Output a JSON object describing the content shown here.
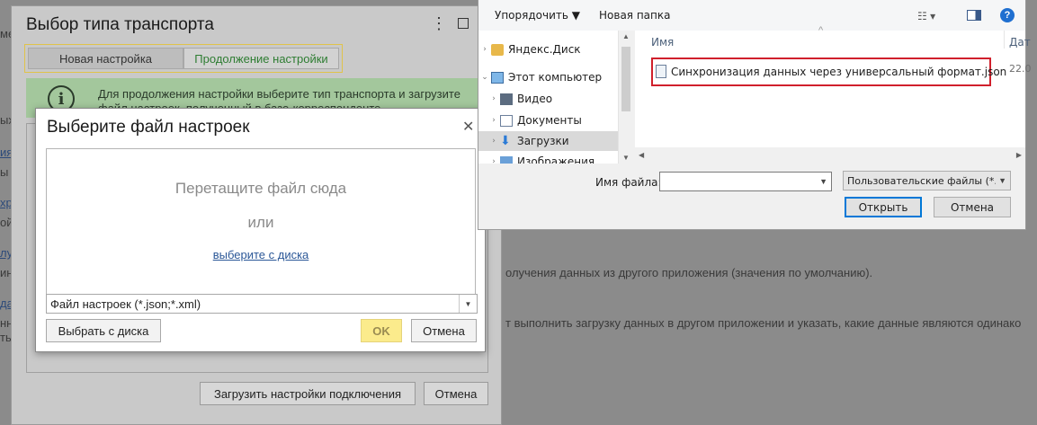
{
  "background": {
    "texts": [
      "мe",
      "ых",
      "ия",
      "ы",
      "хр",
      "ой",
      "лу",
      "инх",
      "дак",
      "нны",
      "ть"
    ],
    "line1": "олучения данных из другого приложения (значения по умолчанию).",
    "line2": "т выполнить загрузку данных в другом приложении и указать, какие данные являются одинако"
  },
  "transport_dialog": {
    "title": "Выбор типа транспорта",
    "tabs": [
      {
        "label": "Новая настройка"
      },
      {
        "label": "Продолжение настройки"
      }
    ],
    "info_text": "Для продолжения настройки выберите тип транспорта и загрузите файл настроек, полученный в базе-корреспонденте",
    "load_button": "Загрузить настройки подключения",
    "cancel_button": "Отмена"
  },
  "choose_file_dialog": {
    "title": "Выберите файл настроек",
    "drop_text": "Перетащите файл сюда",
    "or_text": "или",
    "choose_link": "выберите с диска",
    "filter": "Файл настроек (*.json;*.xml)",
    "choose_from_disk_button": "Выбрать с диска",
    "ok_button": "OK",
    "cancel_button": "Отмена"
  },
  "file_dialog": {
    "toolbar": {
      "organize": "Упорядочить ▼",
      "new_folder": "Новая папка"
    },
    "tree": [
      {
        "label": "Яндекс.Диск",
        "icon": "yandex-disk-icon"
      },
      {
        "label": "Этот компьютер",
        "icon": "computer-icon"
      },
      {
        "label": "Видео",
        "icon": "video-folder-icon"
      },
      {
        "label": "Документы",
        "icon": "documents-folder-icon"
      },
      {
        "label": "Загрузки",
        "icon": "downloads-folder-icon"
      },
      {
        "label": "Изображения",
        "icon": "pictures-folder-icon"
      }
    ],
    "columns": {
      "name": "Имя",
      "date": "Дат"
    },
    "file": {
      "name": "Синхронизация данных через универсальный формат.json",
      "date": "22.0"
    },
    "filename_label": "Имя файла:",
    "filename_value": "",
    "filetype": "Пользовательские файлы (*.json)",
    "open_button": "Открыть",
    "cancel_button": "Отмена"
  },
  "colors": {
    "selected_tab": "#2e7d32",
    "ok_button": "#fbeb8c",
    "highlight": "#d0202c"
  }
}
